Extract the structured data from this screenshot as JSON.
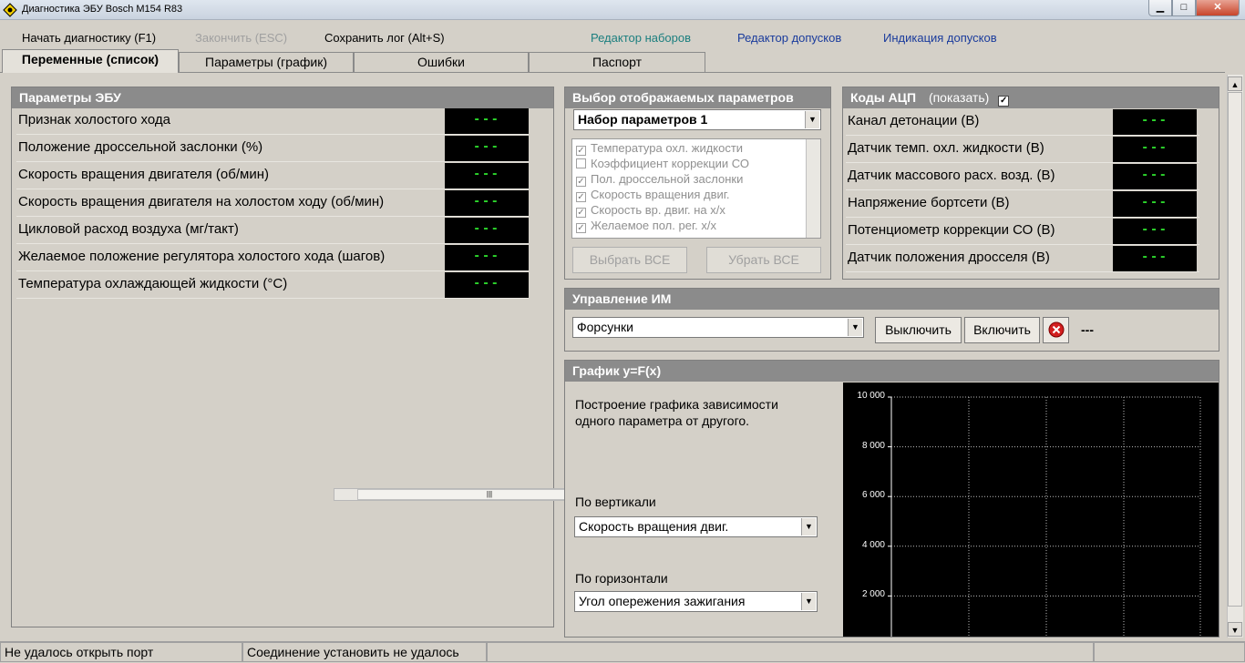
{
  "window": {
    "title": "Диагностика ЭБУ Bosch M154 R83"
  },
  "menu": {
    "start": "Начать диагностику (F1)",
    "finish": "Закончить (ESC)",
    "save_log": "Сохранить лог (Alt+S)",
    "set_editor": "Редактор наборов",
    "tolerance_editor": "Редактор допусков",
    "tolerance_indication": "Индикация допусков"
  },
  "tabs": [
    {
      "label": "Переменные (список)"
    },
    {
      "label": "Параметры (график)"
    },
    {
      "label": "Ошибки"
    },
    {
      "label": "Паспорт"
    }
  ],
  "ecu_params": {
    "title": "Параметры ЭБУ",
    "rows": [
      {
        "label": "Признак холостого хода",
        "value": "---"
      },
      {
        "label": "Положение дроссельной заслонки (%)",
        "value": "---"
      },
      {
        "label": "Скорость вращения двигателя (об/мин)",
        "value": "---"
      },
      {
        "label": "Скорость вращения двигателя на холостом ходу (об/мин)",
        "value": "---"
      },
      {
        "label": "Цикловой расход воздуха (мг/такт)",
        "value": "---"
      },
      {
        "label": "Желаемое положение регулятора холостого хода (шагов)",
        "value": "---"
      },
      {
        "label": "Температура охлаждающей жидкости (°С)",
        "value": "---"
      }
    ]
  },
  "param_select": {
    "title": "Выбор отображаемых параметров",
    "set": "Набор параметров 1",
    "items": [
      {
        "label": "Температура охл. жидкости",
        "checked": "✓"
      },
      {
        "label": "Коэффициент коррекции СО",
        "checked": ""
      },
      {
        "label": "Пол. дроссельной заслонки",
        "checked": "✓"
      },
      {
        "label": "Скорость вращения двиг.",
        "checked": "✓"
      },
      {
        "label": "Скорость вр. двиг. на х/х",
        "checked": "✓"
      },
      {
        "label": "Желаемое пол. рег. х/х",
        "checked": "✓"
      }
    ],
    "select_all": "Выбрать ВСЕ",
    "remove_all": "Убрать ВСЕ"
  },
  "adc": {
    "title": "Коды АЦП",
    "show_label": "(показать)",
    "rows": [
      {
        "label": "Канал детонации (В)",
        "value": "---"
      },
      {
        "label": "Датчик темп. охл. жидкости (В)",
        "value": "---"
      },
      {
        "label": "Датчик массового расх. возд. (В)",
        "value": "---"
      },
      {
        "label": "Напряжение бортсети (В)",
        "value": "---"
      },
      {
        "label": "Потенциометр коррекции СО (В)",
        "value": "---"
      },
      {
        "label": "Датчик положения дросселя (В)",
        "value": "---"
      }
    ]
  },
  "actuator": {
    "title": "Управление ИМ",
    "selected": "Форсунки",
    "off": "Выключить",
    "on": "Включить",
    "state": "---"
  },
  "graph": {
    "title": "График y=F(x)",
    "description": "Построение графика зависимости одного параметра от другого.",
    "vertical_label": "По вертикали",
    "vertical_value": "Скорость вращения двиг.",
    "horizontal_label": "По горизонтали",
    "horizontal_value": "Угол опережения зажигания"
  },
  "chart_data": {
    "type": "scatter",
    "title": "",
    "xlabel": "",
    "ylabel": "",
    "ylim": [
      0,
      10000
    ],
    "y_ticks": [
      "10 000",
      "8 000",
      "6 000",
      "4 000",
      "2 000"
    ],
    "grid": true,
    "series": []
  },
  "status": {
    "port": "Не удалось открыть порт",
    "connection": "Соединение установить не удалось"
  },
  "colors": {
    "value_text": "#2cd62c",
    "panel_header": "#8b8b8b"
  }
}
